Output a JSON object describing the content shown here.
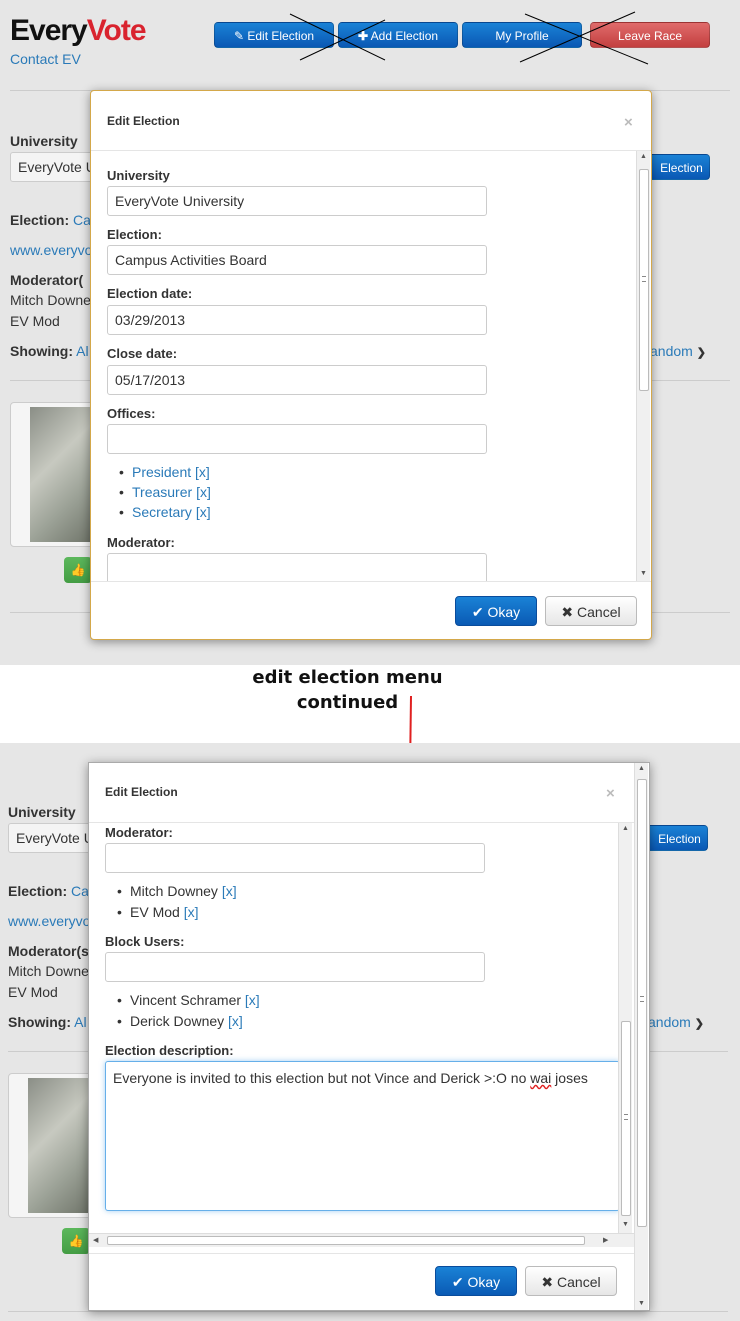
{
  "logo": {
    "every": "Every",
    "vote": "Vote"
  },
  "contact_link": "Contact EV",
  "top_buttons": {
    "edit": "Edit Election",
    "add": "Add Election",
    "profile": "My Profile",
    "leave": "Leave Race"
  },
  "background": {
    "university_label": "University",
    "university_value": "EveryVote U",
    "election_label": "Election:",
    "election_value": "Ca",
    "website": "www.everyvo",
    "moderator_label": "Moderator(",
    "moderator_label_2": "Moderator(s",
    "moderators": [
      "Mitch Downe",
      "EV Mod"
    ],
    "showing_label": "Showing:",
    "showing_value": "Al",
    "right_button": "Election",
    "random_link": "andom"
  },
  "modal": {
    "title": "Edit Election",
    "university_label": "University",
    "university_value": "EveryVote University",
    "election_label": "Election:",
    "election_value": "Campus Activities Board",
    "election_date_label": "Election date:",
    "election_date": "03/29/2013",
    "close_date_label": "Close date:",
    "close_date": "05/17/2013",
    "offices_label": "Offices:",
    "offices": [
      "President",
      "Treasurer",
      "Secretary"
    ],
    "remove": "[x]",
    "moderator_label": "Moderator:",
    "moderators": [
      "Mitch Downey",
      "EV Mod"
    ],
    "block_users_label": "Block Users:",
    "blocked": [
      "Vincent Schramer",
      "Derick Downey"
    ],
    "description_label": "Election description:",
    "description_pre": "Everyone is invited to this election but not Vince and Derick >:O no ",
    "description_typo": "wai",
    "description_post": " joses",
    "ok": "Okay",
    "cancel": "Cancel"
  },
  "annotation": {
    "line1": "edit election menu",
    "line2": "continued"
  },
  "colors": {
    "link": "#2a7ab8",
    "primary": "#0a58b4",
    "danger": "#c33f3f",
    "annotation_arrow": "#e02020"
  }
}
